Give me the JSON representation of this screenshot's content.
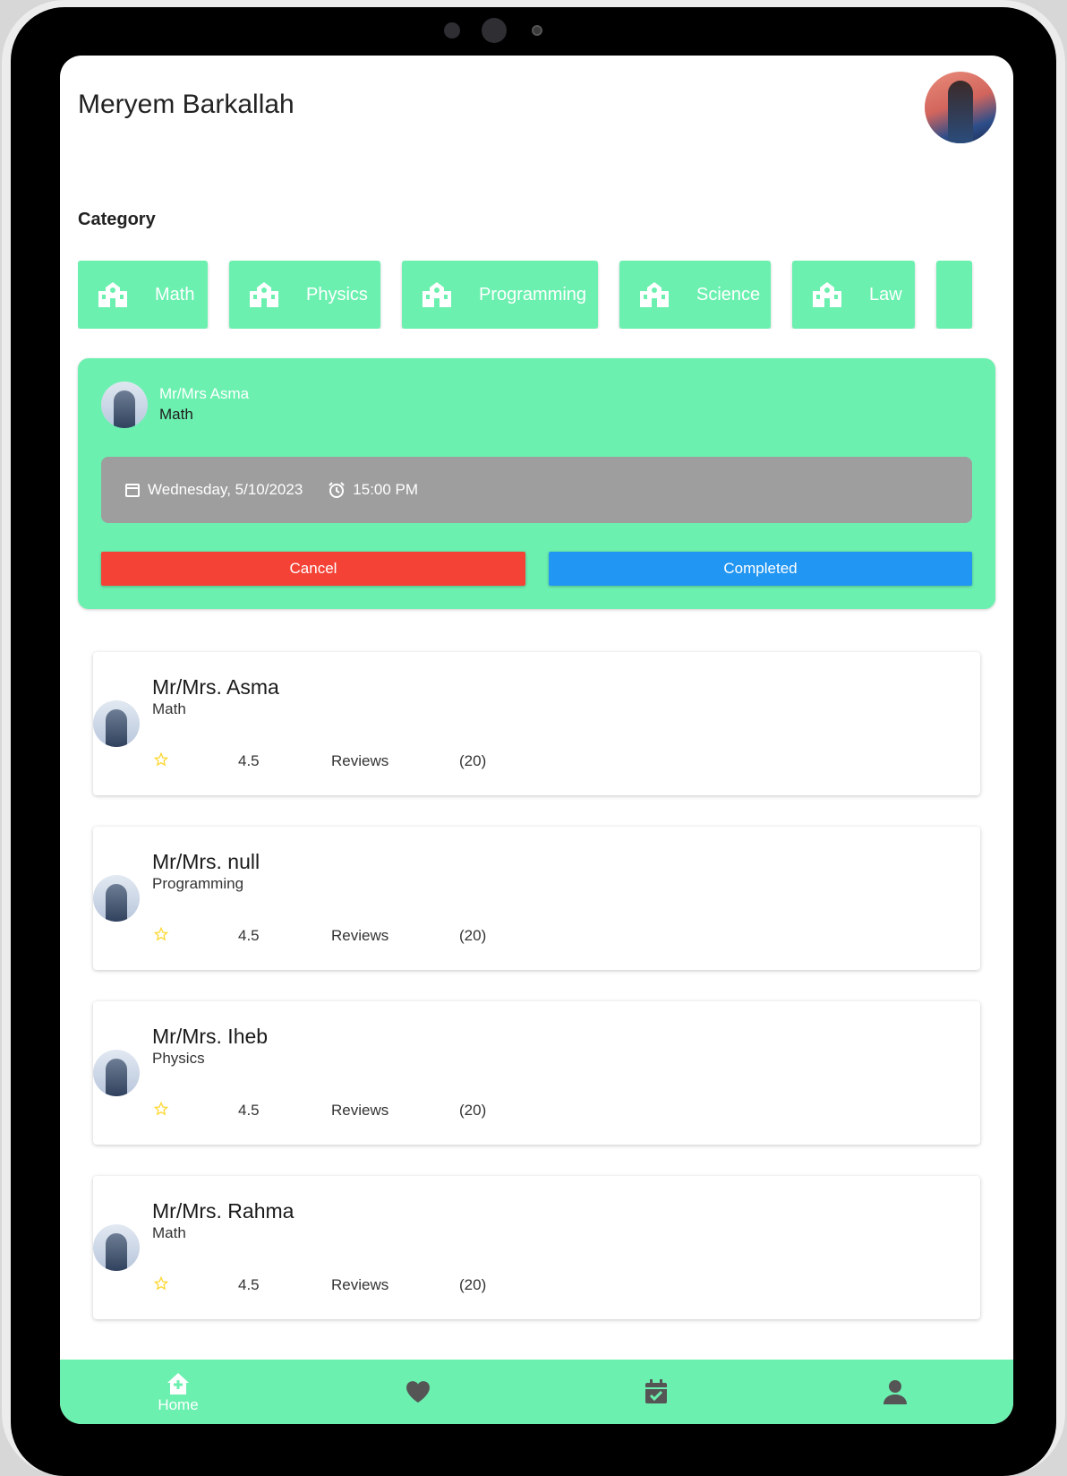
{
  "header": {
    "user_name": "Meryem Barkallah"
  },
  "category_section": {
    "title": "Category",
    "items": [
      {
        "label": "Math",
        "icon": "school-icon"
      },
      {
        "label": "Physics",
        "icon": "school-icon"
      },
      {
        "label": "Programming",
        "icon": "school-icon"
      },
      {
        "label": "Science",
        "icon": "school-icon"
      },
      {
        "label": "Law",
        "icon": "school-icon"
      }
    ]
  },
  "session": {
    "teacher": "Mr/Mrs Asma",
    "subject": "Math",
    "date": "Wednesday, 5/10/2023",
    "time": "15:00 PM",
    "cancel_label": "Cancel",
    "completed_label": "Completed"
  },
  "teachers": [
    {
      "name": "Mr/Mrs. Asma",
      "subject": "Math",
      "rating": "4.5",
      "reviews_label": "Reviews",
      "reviews_count": "(20)"
    },
    {
      "name": "Mr/Mrs. null",
      "subject": "Programming",
      "rating": "4.5",
      "reviews_label": "Reviews",
      "reviews_count": "(20)"
    },
    {
      "name": "Mr/Mrs. Iheb",
      "subject": "Physics",
      "rating": "4.5",
      "reviews_label": "Reviews",
      "reviews_count": "(20)"
    },
    {
      "name": "Mr/Mrs. Rahma",
      "subject": "Math",
      "rating": "4.5",
      "reviews_label": "Reviews",
      "reviews_count": "(20)"
    }
  ],
  "bottom_nav": {
    "home_label": "Home"
  },
  "colors": {
    "accent_green": "#6cf0b0",
    "cancel_red": "#f44336",
    "completed_blue": "#2196f3",
    "datetime_gray": "#9e9e9e",
    "star_yellow": "#fdd835",
    "nav_icon_gray": "#555555"
  }
}
